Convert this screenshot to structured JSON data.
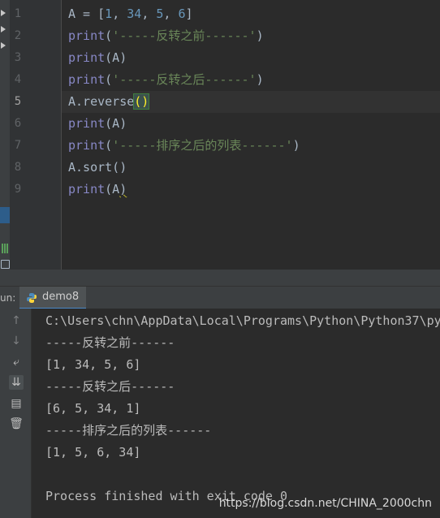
{
  "editor": {
    "line_numbers": [
      "1",
      "2",
      "3",
      "4",
      "5",
      "6",
      "7",
      "8",
      "9"
    ],
    "active_line": "5",
    "lines": [
      [
        {
          "t": "A = [",
          "c": "pl"
        },
        {
          "t": "1",
          "c": "num"
        },
        {
          "t": ", ",
          "c": "pl"
        },
        {
          "t": "34",
          "c": "num"
        },
        {
          "t": ", ",
          "c": "pl"
        },
        {
          "t": "5",
          "c": "num"
        },
        {
          "t": ", ",
          "c": "pl"
        },
        {
          "t": "6",
          "c": "num"
        },
        {
          "t": "]",
          "c": "pl"
        }
      ],
      [
        {
          "t": "print",
          "c": "kw"
        },
        {
          "t": "(",
          "c": "pl"
        },
        {
          "t": "'-----反转之前------'",
          "c": "str"
        },
        {
          "t": ")",
          "c": "pl"
        }
      ],
      [
        {
          "t": "print",
          "c": "kw"
        },
        {
          "t": "(A)",
          "c": "pl"
        }
      ],
      [
        {
          "t": "print",
          "c": "kw"
        },
        {
          "t": "(",
          "c": "pl"
        },
        {
          "t": "'-----反转之后------'",
          "c": "str"
        },
        {
          "t": ")",
          "c": "pl"
        }
      ],
      [
        {
          "t": "A.reverse",
          "c": "pl"
        },
        {
          "t": "()",
          "c": "brace-hl"
        }
      ],
      [
        {
          "t": "print",
          "c": "kw"
        },
        {
          "t": "(A)",
          "c": "pl"
        }
      ],
      [
        {
          "t": "print",
          "c": "kw"
        },
        {
          "t": "(",
          "c": "pl"
        },
        {
          "t": "'-----排序之后的列表------'",
          "c": "str"
        },
        {
          "t": ")",
          "c": "pl"
        }
      ],
      [
        {
          "t": "A.sort()",
          "c": "pl"
        }
      ],
      [
        {
          "t": "print",
          "c": "kw"
        },
        {
          "t": "(A",
          "c": "pl"
        },
        {
          "t": ")",
          "c": "pl squiggle"
        }
      ]
    ]
  },
  "run_panel": {
    "label": "un:",
    "tab_label": "demo8",
    "toolbar_icons": [
      "arrow-up-icon",
      "arrow-down-icon",
      "soft-wrap-icon",
      "scroll-to-end-icon",
      "print-icon",
      "trash-icon"
    ]
  },
  "console": {
    "lines": [
      "C:\\Users\\chn\\AppData\\Local\\Programs\\Python\\Python37\\py",
      "-----反转之前------",
      "[1, 34, 5, 6]",
      "-----反转之后------",
      "[6, 5, 34, 1]",
      "-----排序之后的列表------",
      "[1, 5, 6, 34]",
      "",
      "Process finished with exit code 0"
    ]
  },
  "watermark": "https://blog.csdn.net/CHINA_2000chn",
  "colors": {
    "background": "#2b2b2b",
    "keyword": "#8888c6",
    "number": "#6897bb",
    "string": "#6a8759",
    "text": "#a9b7c6"
  }
}
